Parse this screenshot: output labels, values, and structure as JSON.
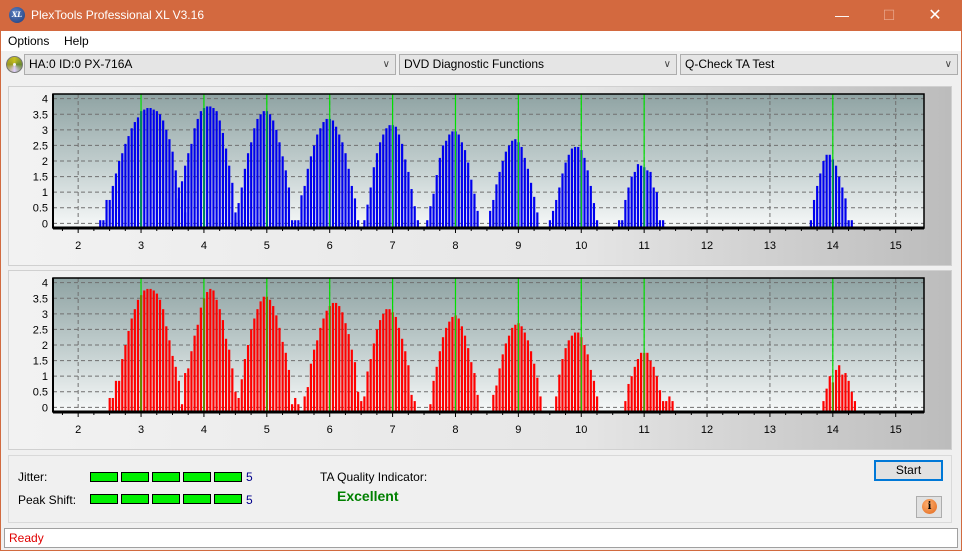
{
  "window": {
    "title": "PlexTools Professional XL V3.16",
    "app_icon_text": "XL",
    "minimize": "—",
    "maximize": "☐",
    "close": "✕"
  },
  "menu": {
    "items": [
      "Options",
      "Help"
    ]
  },
  "toolbar": {
    "drive_select": "HA:0 ID:0  PX-716A",
    "function_select": "DVD Diagnostic Functions",
    "test_select": "Q-Check TA Test",
    "chevron": "∨"
  },
  "colors": {
    "top_bars": "#0000ee",
    "bottom_bars": "#ff0000",
    "reference_lines": "#00e000",
    "quality_text": "#008000",
    "status_text": "#e00000"
  },
  "chart_data": [
    {
      "type": "bar",
      "name": "top-chart",
      "color": "#0000ee",
      "xlim": [
        1.6,
        15.45
      ],
      "ylim": [
        -0.15,
        4.15
      ],
      "xticks": [
        2,
        3,
        4,
        5,
        6,
        7,
        8,
        9,
        10,
        11,
        12,
        13,
        14,
        15
      ],
      "yticks": [
        0,
        0.5,
        1,
        1.5,
        2,
        2.5,
        3,
        3.5,
        4
      ],
      "ytick_labels": [
        "0",
        "0.5",
        "1",
        "1.5",
        "2",
        "2.5",
        "3",
        "3.5",
        "4"
      ],
      "reference_lines": [
        3,
        4,
        5,
        6,
        7,
        8,
        9,
        10,
        11,
        14
      ],
      "grid": true,
      "clusters": [
        {
          "start": 2.35,
          "step": 0.05,
          "values": [
            0.1,
            0.1,
            0.75,
            0.75,
            1.2,
            1.6,
            2.0,
            2.25,
            2.55,
            2.8,
            3.05,
            3.25,
            3.4,
            3.6,
            3.65,
            3.7,
            3.7,
            3.65,
            3.6,
            3.5,
            3.3,
            3.0,
            2.7,
            2.3,
            1.7,
            1.15,
            0.75,
            0.35
          ]
        },
        {
          "start": 3.6,
          "step": 0.05,
          "values": [
            0.8,
            1.35,
            1.85,
            2.25,
            2.55,
            3.05,
            3.35,
            3.6,
            3.7,
            3.75,
            3.75,
            3.7,
            3.6,
            3.3,
            2.9,
            2.4,
            1.85,
            1.3,
            0.35,
            0.1
          ]
        },
        {
          "start": 4.5,
          "step": 0.05,
          "values": [
            0.1,
            0.65,
            1.15,
            1.75,
            2.25,
            2.6,
            3.05,
            3.35,
            3.5,
            3.6,
            3.6,
            3.5,
            3.3,
            3.0,
            2.6,
            2.15,
            1.7,
            1.15,
            0.1,
            0.1,
            0.1
          ]
        },
        {
          "start": 5.55,
          "step": 0.05,
          "values": [
            0.9,
            1.2,
            1.75,
            2.15,
            2.5,
            2.85,
            3.05,
            3.25,
            3.35,
            3.35,
            3.3,
            3.1,
            2.85,
            2.6,
            2.25,
            1.75,
            1.2,
            0.8,
            0.1
          ]
        },
        {
          "start": 6.55,
          "step": 0.05,
          "values": [
            0.1,
            0.6,
            1.15,
            1.8,
            2.25,
            2.6,
            2.85,
            3.05,
            3.15,
            3.15,
            3.1,
            2.85,
            2.55,
            2.05,
            1.65,
            1.1,
            0.55,
            0.1
          ]
        },
        {
          "start": 7.55,
          "step": 0.05,
          "values": [
            0.1,
            0.55,
            0.95,
            1.55,
            2.1,
            2.5,
            2.65,
            2.85,
            2.95,
            2.95,
            2.85,
            2.6,
            2.35,
            1.95,
            1.4,
            0.95,
            0.4
          ]
        },
        {
          "start": 8.55,
          "step": 0.05,
          "values": [
            0.4,
            0.75,
            1.25,
            1.65,
            2.0,
            2.3,
            2.5,
            2.65,
            2.7,
            2.6,
            2.45,
            2.1,
            1.75,
            1.3,
            0.85,
            0.35
          ]
        },
        {
          "start": 9.5,
          "step": 0.05,
          "values": [
            0.1,
            0.4,
            0.75,
            1.15,
            1.6,
            1.95,
            2.2,
            2.4,
            2.45,
            2.45,
            2.35,
            2.1,
            1.7,
            1.2,
            0.65,
            0.1
          ]
        },
        {
          "start": 10.6,
          "step": 0.05,
          "values": [
            0.1,
            0.1,
            0.75,
            1.15,
            1.5,
            1.65,
            1.9,
            1.85,
            1.8,
            1.7,
            1.65,
            1.15,
            1.0,
            0.1,
            0.1
          ]
        },
        {
          "start": 13.65,
          "step": 0.05,
          "values": [
            0.1,
            0.75,
            1.2,
            1.6,
            2.0,
            2.2,
            2.2,
            2.05,
            1.85,
            1.5,
            1.15,
            0.8,
            0.1,
            0.1
          ]
        }
      ]
    },
    {
      "type": "bar",
      "name": "bottom-chart",
      "color": "#ff0000",
      "xlim": [
        1.6,
        15.45
      ],
      "ylim": [
        -0.15,
        4.15
      ],
      "xticks": [
        2,
        3,
        4,
        5,
        6,
        7,
        8,
        9,
        10,
        11,
        12,
        13,
        14,
        15
      ],
      "yticks": [
        0,
        0.5,
        1,
        1.5,
        2,
        2.5,
        3,
        3.5,
        4
      ],
      "ytick_labels": [
        "0",
        "0.5",
        "1",
        "1.5",
        "2",
        "2.5",
        "3",
        "3.5",
        "4"
      ],
      "reference_lines": [
        3,
        4,
        5,
        6,
        7,
        8,
        9,
        10,
        11,
        14
      ],
      "grid": true,
      "clusters": [
        {
          "start": 2.5,
          "step": 0.05,
          "values": [
            0.3,
            0.3,
            0.85,
            0.85,
            1.55,
            2.0,
            2.45,
            2.85,
            3.15,
            3.45,
            3.6,
            3.75,
            3.8,
            3.8,
            3.75,
            3.65,
            3.45,
            3.15,
            2.6,
            2.15,
            1.65,
            1.3,
            0.85,
            0.1
          ]
        },
        {
          "start": 3.7,
          "step": 0.05,
          "values": [
            1.1,
            1.25,
            1.8,
            2.3,
            2.65,
            3.2,
            3.5,
            3.7,
            3.8,
            3.75,
            3.45,
            3.15,
            2.8,
            2.2,
            1.85,
            1.25,
            0.5,
            0.3
          ]
        },
        {
          "start": 4.6,
          "step": 0.05,
          "values": [
            0.9,
            1.55,
            2.0,
            2.5,
            2.85,
            3.15,
            3.4,
            3.55,
            3.55,
            3.45,
            3.25,
            2.95,
            2.55,
            2.1,
            1.75,
            1.2,
            0.1,
            0.3,
            0.1
          ]
        },
        {
          "start": 5.6,
          "step": 0.05,
          "values": [
            0.35,
            0.65,
            1.4,
            1.85,
            2.15,
            2.55,
            2.85,
            3.1,
            3.25,
            3.35,
            3.35,
            3.25,
            3.05,
            2.7,
            2.35,
            1.85,
            1.45,
            0.5,
            0.2
          ]
        },
        {
          "start": 6.55,
          "step": 0.05,
          "values": [
            0.35,
            1.15,
            1.55,
            2.05,
            2.5,
            2.8,
            3.0,
            3.15,
            3.15,
            3.05,
            2.9,
            2.55,
            2.2,
            1.8,
            1.35,
            0.4,
            0.2
          ]
        },
        {
          "start": 7.6,
          "step": 0.05,
          "values": [
            0.1,
            0.85,
            1.3,
            1.8,
            2.25,
            2.55,
            2.75,
            2.9,
            2.95,
            2.85,
            2.6,
            2.3,
            1.9,
            1.45,
            1.1,
            0.4
          ]
        },
        {
          "start": 8.6,
          "step": 0.05,
          "values": [
            0.4,
            0.7,
            1.25,
            1.7,
            2.05,
            2.3,
            2.55,
            2.65,
            2.7,
            2.6,
            2.4,
            2.15,
            1.8,
            1.4,
            0.95,
            0.35
          ]
        },
        {
          "start": 9.6,
          "step": 0.05,
          "values": [
            0.35,
            1.05,
            1.55,
            1.9,
            2.15,
            2.3,
            2.4,
            2.4,
            2.25,
            2.0,
            1.7,
            1.2,
            0.85,
            0.35
          ]
        },
        {
          "start": 10.7,
          "step": 0.05,
          "values": [
            0.2,
            0.75,
            1.0,
            1.3,
            1.55,
            1.75,
            1.75,
            1.75,
            1.5,
            1.3,
            1.0,
            0.55,
            0.2,
            0.2,
            0.35,
            0.2
          ]
        },
        {
          "start": 13.85,
          "step": 0.05,
          "values": [
            0.2,
            0.6,
            1.0,
            0.8,
            1.2,
            1.35,
            1.05,
            1.1,
            0.85,
            0.5,
            0.2
          ]
        }
      ]
    }
  ],
  "metrics": {
    "jitter_label": "Jitter:",
    "jitter_value": "5",
    "jitter_segments": 5,
    "peak_shift_label": "Peak Shift:",
    "peak_shift_value": "5",
    "peak_shift_segments": 5,
    "ta_quality_label": "TA Quality Indicator:",
    "ta_quality_value": "Excellent"
  },
  "buttons": {
    "start": "Start",
    "info_icon": "i"
  },
  "status": {
    "text": "Ready"
  }
}
